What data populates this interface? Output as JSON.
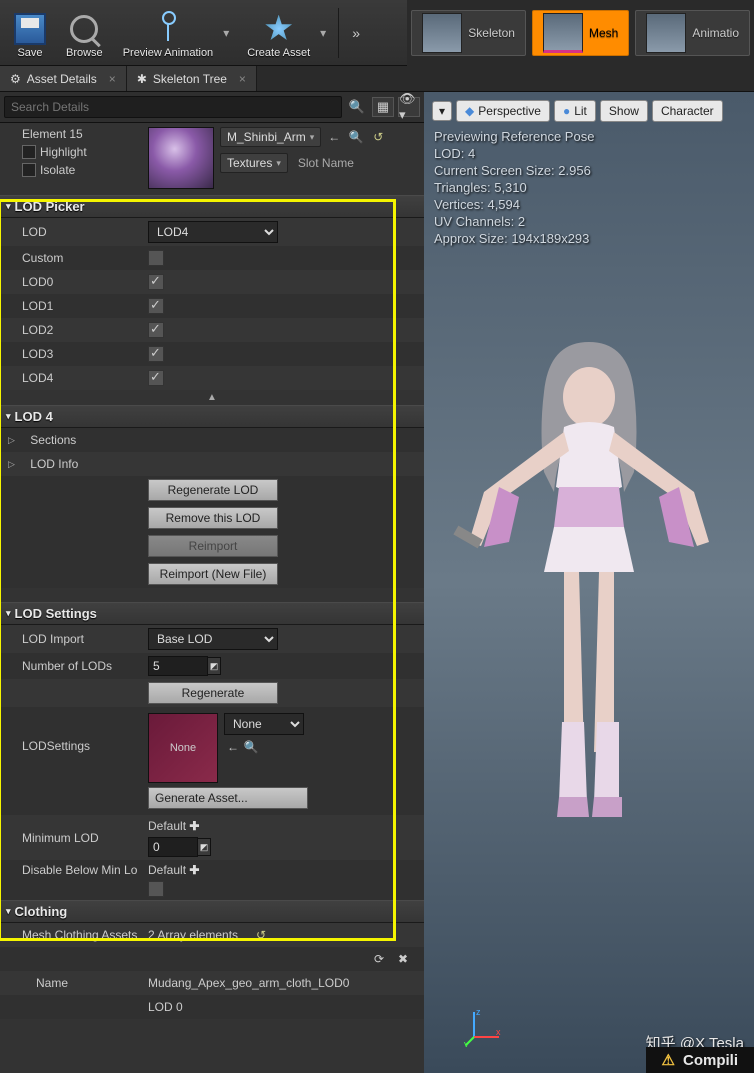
{
  "toolbar": {
    "save": "Save",
    "browse": "Browse",
    "preview": "Preview Animation",
    "create": "Create Asset"
  },
  "modes": {
    "skeleton": "Skeleton",
    "mesh": "Mesh",
    "animation": "Animatio"
  },
  "tabs": {
    "asset_details": "Asset Details",
    "skeleton_tree": "Skeleton Tree"
  },
  "search_placeholder": "Search Details",
  "material": {
    "element": "Element 15",
    "highlight": "Highlight",
    "isolate": "Isolate",
    "name": "M_Shinbi_Arm",
    "textures": "Textures",
    "slot": "Slot Name"
  },
  "lod_picker": {
    "header": "LOD Picker",
    "lod_label": "LOD",
    "lod_value": "LOD4",
    "custom": "Custom",
    "lods": [
      "LOD0",
      "LOD1",
      "LOD2",
      "LOD3",
      "LOD4"
    ]
  },
  "lod4": {
    "header": "LOD 4",
    "sections": "Sections",
    "lodinfo": "LOD Info",
    "regen": "Regenerate LOD",
    "remove": "Remove this LOD",
    "reimport": "Reimport",
    "reimport_new": "Reimport (New File)"
  },
  "lod_settings": {
    "header": "LOD Settings",
    "import_label": "LOD Import",
    "import_value": "Base LOD",
    "num_label": "Number of LODs",
    "num_value": "5",
    "regen": "Regenerate",
    "lodsettings_label": "LODSettings",
    "none": "None",
    "none_combo": "None",
    "gen_asset": "Generate Asset...",
    "min_lod_label": "Minimum LOD",
    "default": "Default",
    "min_val": "0",
    "disable_label": "Disable Below Min Lo"
  },
  "clothing": {
    "header": "Clothing",
    "mesh_assets": "Mesh Clothing Assets",
    "array": "2 Array elements",
    "name_label": "Name",
    "name_value": "Mudang_Apex_geo_arm_cloth_LOD0",
    "lod0": "LOD 0"
  },
  "viewport": {
    "perspective": "Perspective",
    "lit": "Lit",
    "show": "Show",
    "character": "Character",
    "stats": {
      "l1": "Previewing Reference Pose",
      "l2": "LOD: 4",
      "l3": "Current Screen Size: 2.956",
      "l4": "Triangles: 5,310",
      "l5": "Vertices: 4,594",
      "l6": "UV Channels: 2",
      "l7": "Approx Size: 194x189x293"
    }
  },
  "watermark": "知乎 @X Tesla",
  "compiling": "Compili"
}
